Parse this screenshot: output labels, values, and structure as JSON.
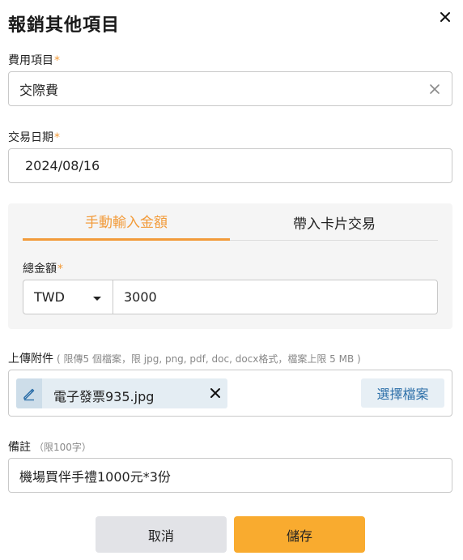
{
  "dialog": {
    "title": "報銷其他項目"
  },
  "expense_item": {
    "label": "費用項目",
    "required_mark": "*",
    "value": "交際費"
  },
  "transaction_date": {
    "label": "交易日期",
    "required_mark": "*",
    "value": "2024/08/16"
  },
  "amount_section": {
    "tabs": [
      {
        "label": "手動輸入金額",
        "active": true
      },
      {
        "label": "帶入卡片交易",
        "active": false
      }
    ],
    "total_label": "總金額",
    "required_mark": "*",
    "currency": "TWD",
    "amount": "3000"
  },
  "attachments": {
    "label": "上傳附件",
    "hint": "( 限傳5 個檔案，限 jpg, png, pdf, doc, docx格式，檔案上限 5 MB )",
    "files": [
      {
        "name": "電子發票935.jpg"
      }
    ],
    "choose_button": "選擇檔案"
  },
  "notes": {
    "label": "備註",
    "hint": "（限100字）",
    "value": "機場買伴手禮1000元*3份"
  },
  "actions": {
    "cancel": "取消",
    "save": "儲存"
  },
  "colors": {
    "accent": "#f29b3a",
    "save_button": "#f9ab2f",
    "link_blue": "#2b6ea8"
  },
  "icons": [
    "close-icon",
    "clear-icon",
    "chevron-down-icon",
    "edit-pencil-icon",
    "remove-file-icon"
  ]
}
